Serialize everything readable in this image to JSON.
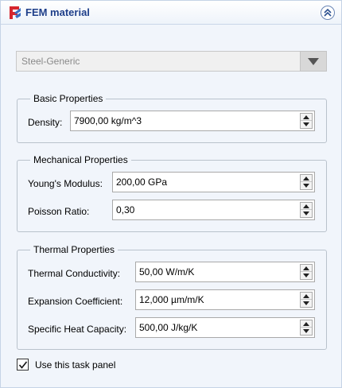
{
  "header": {
    "title": "FEM material",
    "icon": "fem-material-icon",
    "collapse_icon": "collapse-up-icon"
  },
  "material_select": {
    "value": "Steel-Generic",
    "disabled": true
  },
  "groups": {
    "basic": {
      "title": "Basic Properties",
      "density": {
        "label": "Density:",
        "value": "7900,00 kg/m^3"
      }
    },
    "mechanical": {
      "title": "Mechanical Properties",
      "youngs_modulus": {
        "label": "Young's Modulus:",
        "value": "200,00 GPa"
      },
      "poisson_ratio": {
        "label": "Poisson Ratio:",
        "value": "0,30"
      }
    },
    "thermal": {
      "title": "Thermal Properties",
      "thermal_conductivity": {
        "label": "Thermal Conductivity:",
        "value": "50,00 W/m/K"
      },
      "expansion_coefficient": {
        "label": "Expansion Coefficient:",
        "value": "12,000 µm/m/K"
      },
      "specific_heat_capacity": {
        "label": "Specific Heat Capacity:",
        "value": "500,00 J/kg/K"
      }
    }
  },
  "use_task_panel": {
    "label": "Use this task panel",
    "checked": true
  },
  "colors": {
    "title": "#1f3f8a",
    "panel_bg": "#f1f5fb",
    "icon_red": "#d6262e",
    "icon_blue": "#3a6fc4"
  }
}
